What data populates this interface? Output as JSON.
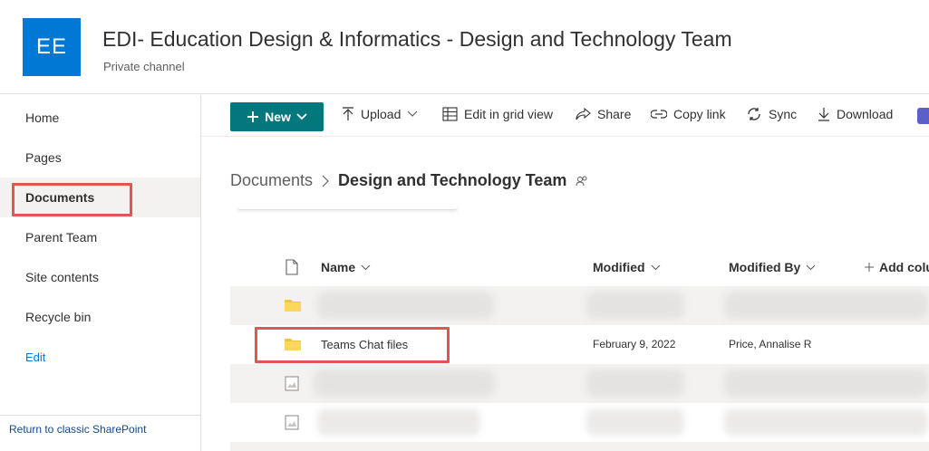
{
  "site": {
    "logo_text": "EE",
    "title": "EDI- Education Design & Informatics - Design and Technology Team",
    "subtitle": "Private channel",
    "brand_color": "#0078d4"
  },
  "nav": {
    "items": [
      {
        "label": "Home"
      },
      {
        "label": "Pages"
      },
      {
        "label": "Documents",
        "selected": true
      },
      {
        "label": "Parent Team"
      },
      {
        "label": "Site contents"
      },
      {
        "label": "Recycle bin"
      },
      {
        "label": "Edit"
      }
    ],
    "footer_link": "Return to classic SharePoint"
  },
  "commands": {
    "new_label": "New",
    "upload": "Upload",
    "edit_grid": "Edit in grid view",
    "share": "Share",
    "copy_link": "Copy link",
    "sync": "Sync",
    "download": "Download",
    "accent_color": "#03787c"
  },
  "breadcrumb": {
    "root": "Documents",
    "current": "Design and Technology Team"
  },
  "list": {
    "columns": {
      "name": "Name",
      "modified": "Modified",
      "modified_by": "Modified By",
      "add_column": "Add colu"
    },
    "rows": [
      {
        "type": "folder",
        "name": "",
        "modified": "",
        "modified_by": "",
        "blurred": true
      },
      {
        "type": "folder",
        "name": "Teams Chat files",
        "modified": "February 9, 2022",
        "modified_by": "Price, Annalise R"
      },
      {
        "type": "image",
        "name": "",
        "modified": "",
        "modified_by": "",
        "blurred": true
      },
      {
        "type": "image",
        "name": "",
        "modified": "",
        "modified_by": "",
        "blurred": true
      }
    ]
  },
  "highlight_color": "#e05656"
}
